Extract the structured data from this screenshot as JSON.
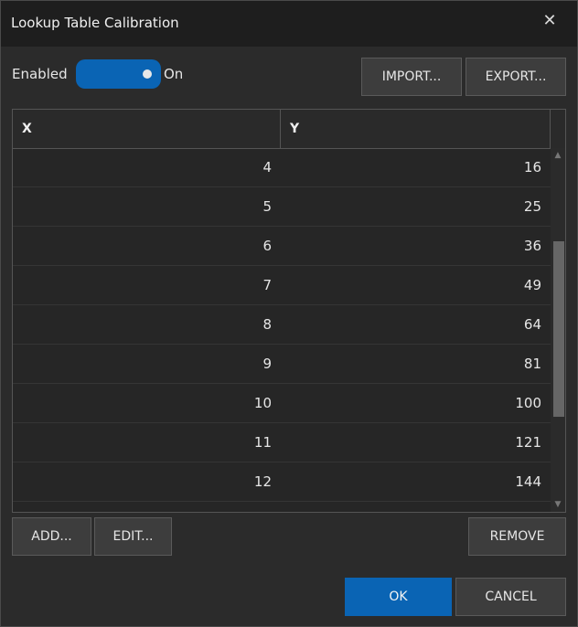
{
  "window": {
    "title": "Lookup Table Calibration",
    "close_glyph": "✕"
  },
  "toggle": {
    "label": "Enabled",
    "state_label": "On",
    "is_on": true,
    "accent_color": "#0a64b4"
  },
  "toolbar": {
    "import_label": "IMPORT...",
    "export_label": "EXPORT..."
  },
  "table": {
    "columns": [
      "X",
      "Y"
    ],
    "rows": [
      {
        "x": "4",
        "y": "16"
      },
      {
        "x": "5",
        "y": "25"
      },
      {
        "x": "6",
        "y": "36"
      },
      {
        "x": "7",
        "y": "49"
      },
      {
        "x": "8",
        "y": "64"
      },
      {
        "x": "9",
        "y": "81"
      },
      {
        "x": "10",
        "y": "100"
      },
      {
        "x": "11",
        "y": "121"
      },
      {
        "x": "12",
        "y": "144"
      }
    ]
  },
  "actions": {
    "add_label": "ADD...",
    "edit_label": "EDIT...",
    "remove_label": "REMOVE"
  },
  "dialog": {
    "ok_label": "OK",
    "cancel_label": "CANCEL"
  },
  "icons": {
    "close": "close-icon",
    "scroll_up": "chevron-up-icon",
    "scroll_down": "chevron-down-icon"
  }
}
